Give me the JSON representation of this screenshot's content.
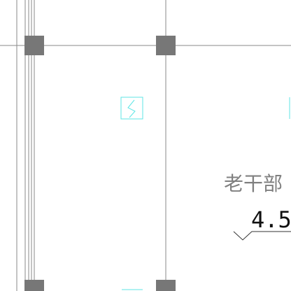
{
  "drawing": {
    "room_label": "老干部",
    "level_value": "4.5",
    "colors": {
      "background": "#ffffff",
      "grid_line": "#8a8a8a",
      "column_fill": "#777777",
      "symbol_cyan": "#5fe6e6",
      "room_text": "#808080",
      "level_text": "#111111",
      "level_marker": "#333333"
    },
    "symbols": {
      "window_mark_icon": "cyan-boxed-s-mark"
    }
  }
}
